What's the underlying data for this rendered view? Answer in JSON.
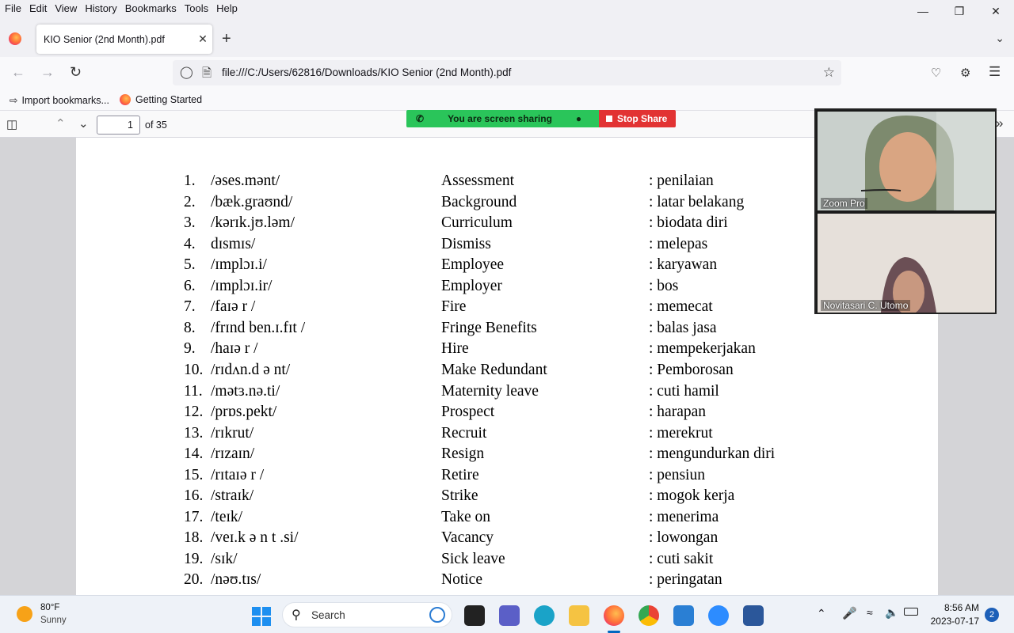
{
  "menubar": {
    "items": [
      "File",
      "Edit",
      "View",
      "History",
      "Bookmarks",
      "Tools",
      "Help"
    ]
  },
  "tab": {
    "title": "KIO Senior (2nd Month).pdf"
  },
  "navbar": {
    "url": "file:///C:/Users/62816/Downloads/KIO Senior (2nd Month).pdf"
  },
  "bookmarks": {
    "import": "Import bookmarks...",
    "getting_started": "Getting Started"
  },
  "pdf_toolbar": {
    "page_number": "1",
    "page_total": "of 35"
  },
  "screen_share": {
    "status": "You are screen sharing",
    "stop_label": "Stop Share",
    "colors": {
      "banner": "#2ac55a",
      "stop": "#e23333"
    }
  },
  "vocabulary": [
    {
      "num": "1.",
      "ipa": "/əses.mənt/",
      "word": "Assessment",
      "meaning": ": penilaian"
    },
    {
      "num": "2.",
      "ipa": "/bæk.graʊnd/",
      "word": "Background",
      "meaning": ": latar belakang"
    },
    {
      "num": "3.",
      "ipa": "/kərɪk.jʊ.ləm/",
      "word": "Curriculum",
      "meaning": ": biodata diri"
    },
    {
      "num": "4.",
      "ipa": "dɪsmɪs/",
      "word": "Dismiss",
      "meaning": ": melepas"
    },
    {
      "num": "5.",
      "ipa": "/ɪmplɔɪ.i/",
      "word": "Employee",
      "meaning": ": karyawan"
    },
    {
      "num": "6.",
      "ipa": "/ɪmplɔɪ.ir/",
      "word": "Employer",
      "meaning": ": bos"
    },
    {
      "num": "7.",
      "ipa": "/faɪə r /",
      "word": "Fire",
      "meaning": ": memecat"
    },
    {
      "num": "8.",
      "ipa": "/frɪnd ben.ɪ.fɪt /",
      "word": "Fringe Benefits",
      "meaning": ": balas jasa"
    },
    {
      "num": "9.",
      "ipa": "/haɪə r /",
      "word": "Hire",
      "meaning": ": mempekerjakan"
    },
    {
      "num": "10.",
      "ipa": "/rɪdʌn.d ə nt/",
      "word": "Make Redundant",
      "meaning": ": Pemborosan"
    },
    {
      "num": "11.",
      "ipa": "/mətɜ.nə.ti/",
      "word": "Maternity leave",
      "meaning": ": cuti hamil"
    },
    {
      "num": "12.",
      "ipa": "/prɒs.pekt/",
      "word": "Prospect",
      "meaning": ": harapan"
    },
    {
      "num": "13.",
      "ipa": "/rɪkrut/",
      "word": "Recruit",
      "meaning": ": merekrut"
    },
    {
      "num": "14.",
      "ipa": "/rɪzaɪn/",
      "word": "Resign",
      "meaning": ": mengundurkan diri"
    },
    {
      "num": "15.",
      "ipa": "/rɪtaɪə r /",
      "word": "Retire",
      "meaning": ": pensiun"
    },
    {
      "num": "16.",
      "ipa": "/straɪk/",
      "word": "Strike",
      "meaning": ": mogok kerja"
    },
    {
      "num": "17.",
      "ipa": "/teɪk/",
      "word": "Take on",
      "meaning": ": menerima"
    },
    {
      "num": "18.",
      "ipa": "/veɪ.k ə n t  .si/",
      "word": "Vacancy",
      "meaning": ": lowongan"
    },
    {
      "num": "19.",
      "ipa": "/sɪk/",
      "word": "Sick leave",
      "meaning": ": cuti sakit"
    },
    {
      "num": "20.",
      "ipa": "/nəʊ.tɪs/",
      "word": "Notice",
      "meaning": ": peringatan"
    }
  ],
  "zoom": {
    "participants": [
      "Zoom Pro",
      "Novitasari C. Utomo"
    ]
  },
  "taskbar": {
    "weather_temp": "80°F",
    "weather_cond": "Sunny",
    "search_label": "Search",
    "time": "8:56 AM",
    "date": "2023-07-17",
    "notifications": "2"
  }
}
